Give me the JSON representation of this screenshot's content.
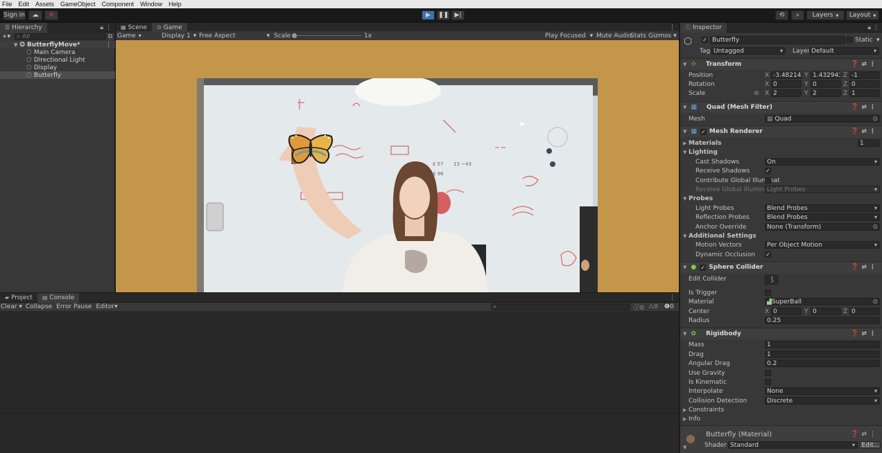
{
  "menu": [
    "File",
    "Edit",
    "Assets",
    "GameObject",
    "Component",
    "Window",
    "Help"
  ],
  "toolbar": {
    "sign_in": "Sign in",
    "layers": "Layers",
    "layout": "Layout"
  },
  "hierarchy": {
    "tab": "Hierarchy",
    "search_placeholder": "All",
    "scene": "ButterflyMove*",
    "items": [
      "Main Camera",
      "Directional Light",
      "Display",
      "Butterfly"
    ]
  },
  "game": {
    "tabs": [
      "Scene",
      "Game"
    ],
    "toolbar": {
      "mode": "Game",
      "display": "Display 1",
      "aspect": "Free Aspect",
      "scale_label": "Scale",
      "scale_value": "1x",
      "play_focused": "Play Focused",
      "mute": "Mute Audio",
      "stats": "Stats",
      "gizmos": "Gizmos"
    }
  },
  "console": {
    "tabs": [
      "Project",
      "Console"
    ],
    "toolbar": {
      "clear": "Clear",
      "collapse": "Collapse",
      "error_pause": "Error Pause",
      "editor": "Editor"
    },
    "counts": {
      "logs": "0",
      "warnings": "0",
      "errors": "0"
    }
  },
  "inspector": {
    "tab": "Inspector",
    "object_name": "Butterfly",
    "static": "Static",
    "tag_label": "Tag",
    "tag_value": "Untagged",
    "layer_label": "Layer",
    "layer_value": "Default",
    "transform": {
      "title": "Transform",
      "position": {
        "label": "Position",
        "x": "-3.482143",
        "y": "1.432943",
        "z": "-1"
      },
      "rotation": {
        "label": "Rotation",
        "x": "0",
        "y": "0",
        "z": "0"
      },
      "scale": {
        "label": "Scale",
        "x": "2",
        "y": "2",
        "z": "1"
      }
    },
    "mesh_filter": {
      "title": "Quad (Mesh Filter)",
      "mesh_label": "Mesh",
      "mesh_value": "Quad"
    },
    "mesh_renderer": {
      "title": "Mesh Renderer",
      "materials": "Materials",
      "materials_count": "1",
      "lighting": "Lighting",
      "cast_shadows": "Cast Shadows",
      "cast_shadows_value": "On",
      "receive_shadows": "Receive Shadows",
      "contribute_gi": "Contribute Global Illuminat",
      "receive_gi": "Receive Global Illuminatio",
      "receive_gi_value": "Light Probes",
      "probes": "Probes",
      "light_probes": "Light Probes",
      "light_probes_value": "Blend Probes",
      "reflection_probes": "Reflection Probes",
      "reflection_probes_value": "Blend Probes",
      "anchor_override": "Anchor Override",
      "anchor_override_value": "None (Transform)",
      "additional": "Additional Settings",
      "motion_vectors": "Motion Vectors",
      "motion_vectors_value": "Per Object Motion",
      "dynamic_occlusion": "Dynamic Occlusion"
    },
    "sphere_collider": {
      "title": "Sphere Collider",
      "edit_collider": "Edit Collider",
      "is_trigger": "Is Trigger",
      "material": "Material",
      "material_value": "SuperBall",
      "center": "Center",
      "cx": "0",
      "cy": "0",
      "cz": "0",
      "radius": "Radius",
      "radius_value": "0.25"
    },
    "rigidbody": {
      "title": "Rigidbody",
      "mass": "Mass",
      "mass_value": "1",
      "drag": "Drag",
      "drag_value": "1",
      "angular_drag": "Angular Drag",
      "angular_drag_value": "0.2",
      "use_gravity": "Use Gravity",
      "is_kinematic": "Is Kinematic",
      "interpolate": "Interpolate",
      "interpolate_value": "None",
      "collision": "Collision Detection",
      "collision_value": "Discrete",
      "constraints": "Constraints",
      "info": "Info"
    },
    "material": {
      "title": "Butterfly (Material)",
      "shader_label": "Shader",
      "shader_value": "Standard",
      "edit": "Edit..."
    }
  },
  "colors": {
    "accent": "#3a72b0",
    "game_bg": "#c3964a",
    "selection": "#4d4d4d"
  }
}
